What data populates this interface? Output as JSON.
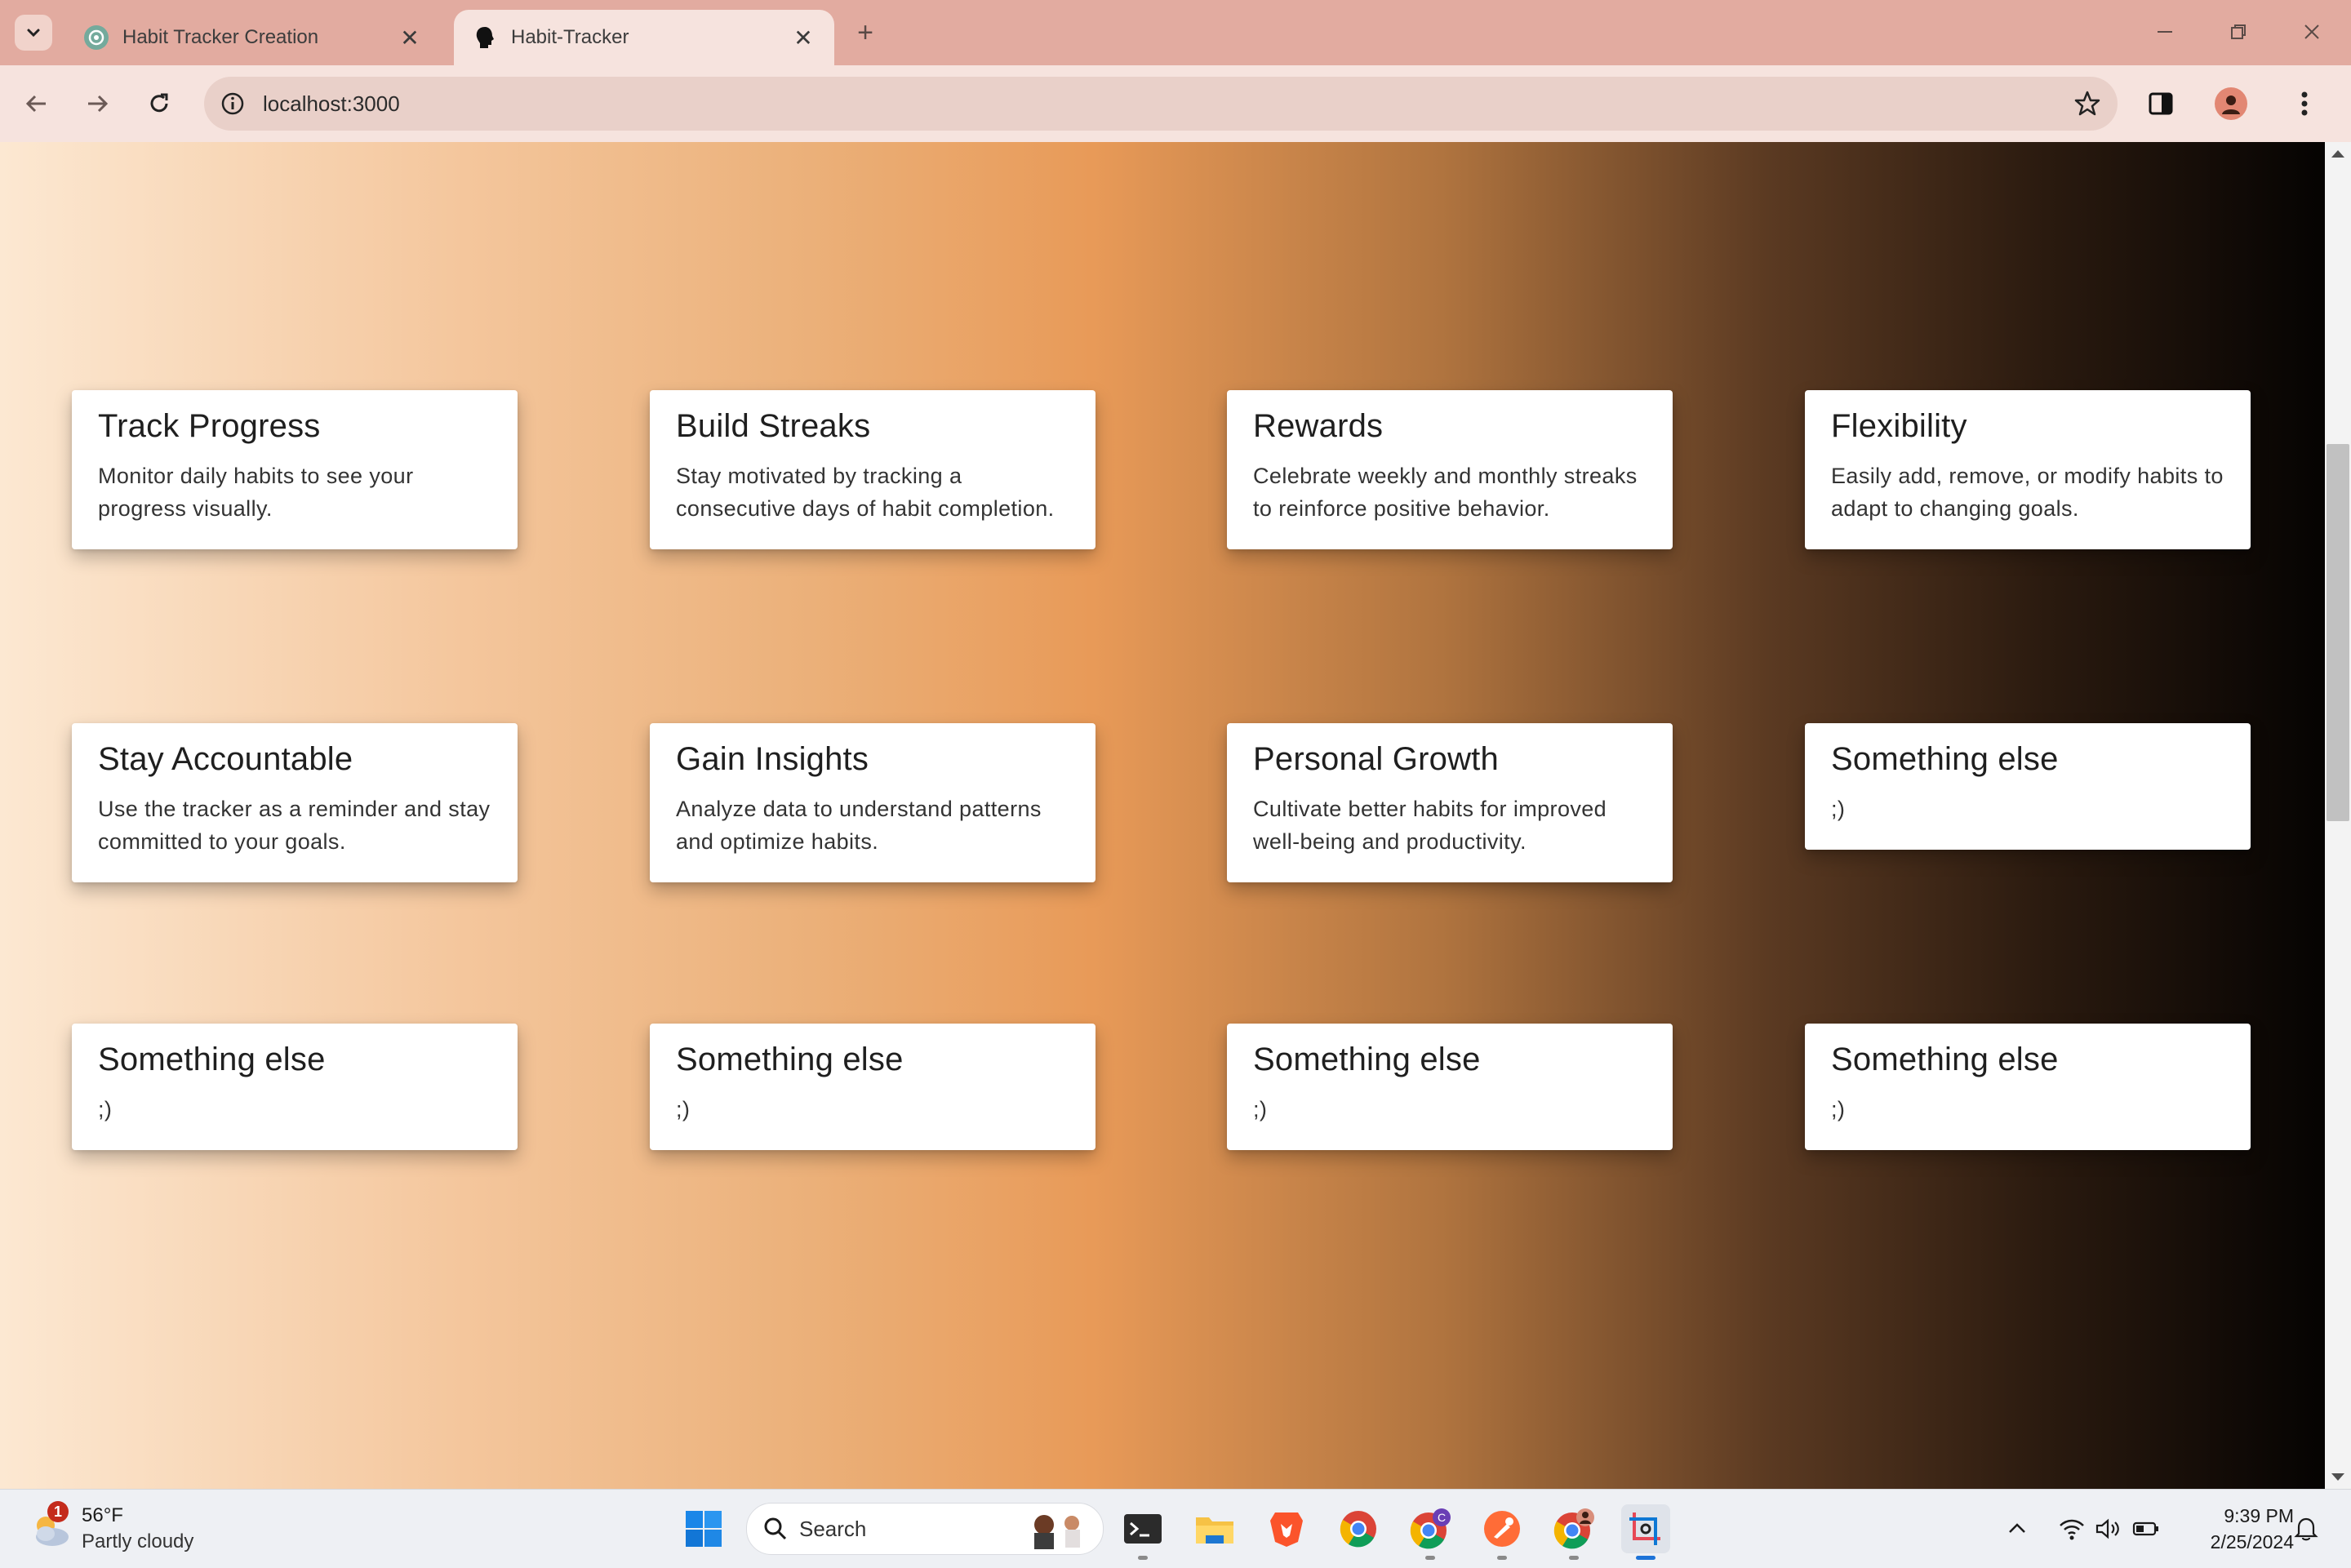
{
  "browser": {
    "tabs": [
      {
        "title": "Habit Tracker Creation",
        "active": false,
        "favicon": "chatgpt-icon"
      },
      {
        "title": "Habit-Tracker",
        "active": true,
        "favicon": "head-silhouette-icon"
      }
    ],
    "url": "localhost:3000"
  },
  "cards": [
    {
      "title": "Track Progress",
      "text": "Monitor daily habits to see your progress visually."
    },
    {
      "title": "Build Streaks",
      "text": "Stay motivated by tracking a consecutive days of habit completion."
    },
    {
      "title": "Rewards",
      "text": "Celebrate weekly and monthly streaks to reinforce positive behavior."
    },
    {
      "title": "Flexibility",
      "text": "Easily add, remove, or modify habits to adapt to changing goals."
    },
    {
      "title": "Stay Accountable",
      "text": "Use the tracker as a reminder and stay committed to your goals."
    },
    {
      "title": "Gain Insights",
      "text": "Analyze data to understand patterns and optimize habits."
    },
    {
      "title": "Personal Growth",
      "text": "Cultivate better habits for improved well-being and productivity."
    },
    {
      "title": "Something else",
      "text": ";)"
    },
    {
      "title": "Something else",
      "text": ";)"
    },
    {
      "title": "Something else",
      "text": ";)"
    },
    {
      "title": "Something else",
      "text": ";)"
    },
    {
      "title": "Something else",
      "text": ";)"
    }
  ],
  "taskbar": {
    "weather": {
      "badge": "1",
      "temp": "56°F",
      "condition": "Partly cloudy"
    },
    "search_placeholder": "Search",
    "apps": [
      "windows-start-icon",
      "terminal-icon",
      "file-explorer-icon",
      "brave-icon",
      "chrome-icon",
      "chrome-profile-icon",
      "postman-icon",
      "chrome-profile-2-icon",
      "snipping-tool-icon"
    ],
    "time": "9:39 PM",
    "date": "2/25/2024"
  },
  "colors": {
    "gradient": [
      "#fce8d2",
      "#e89a58",
      "#050302"
    ],
    "tabbar": "#e2aba0",
    "toolbar": "#f6e3de"
  }
}
